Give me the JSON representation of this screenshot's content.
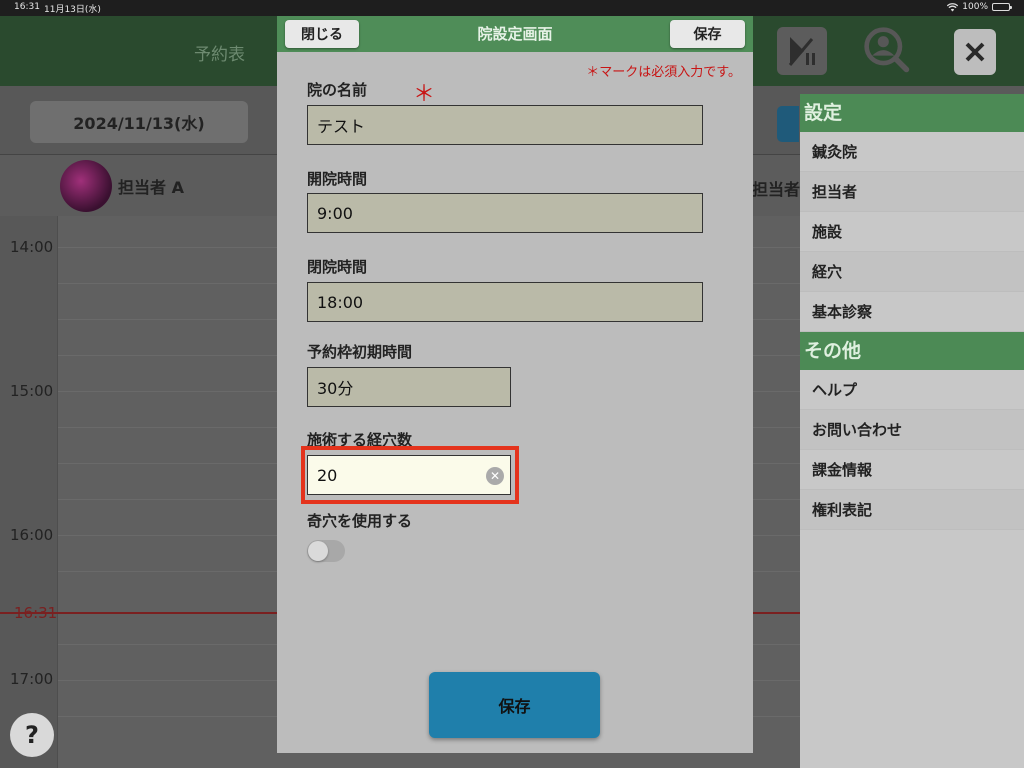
{
  "status_bar": {
    "time": "16:31",
    "date": "11月13日(水)",
    "battery": "100%"
  },
  "app": {
    "title": "予約表",
    "date_button": "2024/11/13(水)",
    "staff": [
      "担当者 A",
      "担当者"
    ],
    "time_labels": [
      "14:00",
      "15:00",
      "16:00",
      "17:00"
    ],
    "now_label": "16:31",
    "help_label": "?"
  },
  "modal": {
    "title": "院設定画面",
    "close_label": "閉じる",
    "save_label": "保存",
    "required_note": "＊マークは必須入力です。",
    "required_mark": "＊",
    "fields": {
      "name": {
        "label": "院の名前",
        "value": "テスト"
      },
      "open": {
        "label": "開院時間",
        "value": "9:00"
      },
      "close": {
        "label": "閉院時間",
        "value": "18:00"
      },
      "slot": {
        "label": "予約枠初期時間",
        "value": "30分"
      },
      "points": {
        "label": "施術する経穴数",
        "value": "20"
      },
      "extra": {
        "label": "奇穴を使用する",
        "enabled": false
      }
    },
    "bottom_save_label": "保存"
  },
  "side_menu": {
    "sections": [
      {
        "title": "設定",
        "items": [
          "鍼灸院",
          "担当者",
          "施設",
          "経穴",
          "基本診察"
        ]
      },
      {
        "title": "その他",
        "items": [
          "ヘルプ",
          "お問い合わせ",
          "課金情報",
          "権利表記"
        ]
      }
    ]
  },
  "colors": {
    "header_green": "#4f8d58",
    "highlight": "#e4331c",
    "required_red": "#c81414",
    "primary_blue": "#1f7fab"
  }
}
